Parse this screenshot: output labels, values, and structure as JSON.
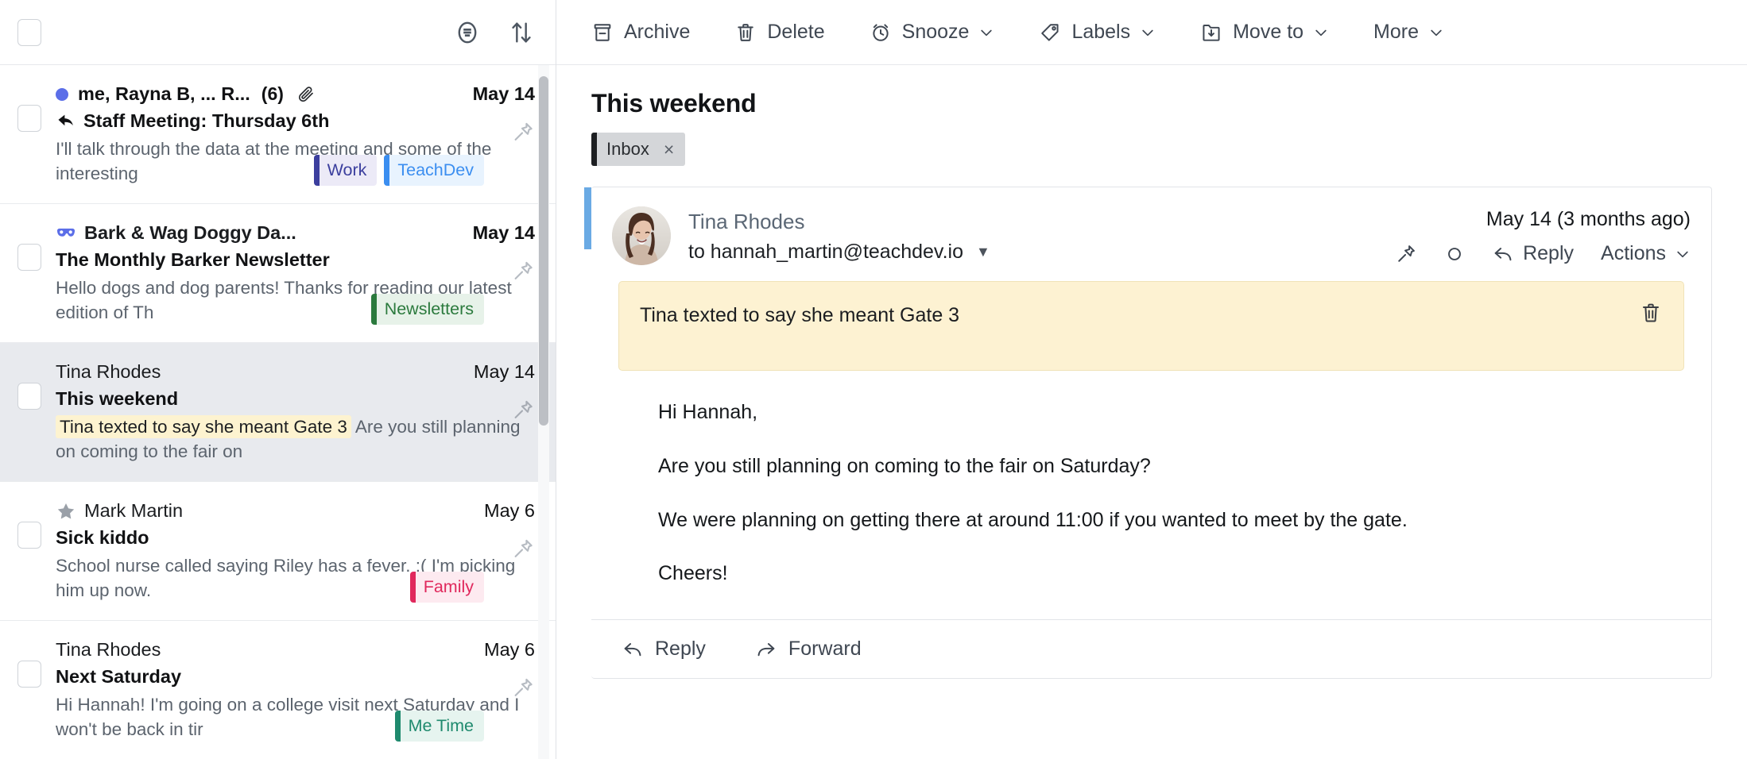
{
  "list_header": {
    "select_all_checkbox": "",
    "filter_icon": "filter-icon",
    "sort_icon": "sort-icon"
  },
  "messages": [
    {
      "sender": "me, Rayna B, ... R...",
      "count": "(6)",
      "date": "May 14",
      "subject": "Staff Meeting: Thursday 6th",
      "snippet": "I'll talk through the data at the meeting and some of the interesting",
      "unread": true,
      "has_attachment": true,
      "replied": true,
      "pre_icon": "",
      "labels": [
        {
          "text": "Work",
          "bar": "#3c3f9e",
          "bg": "#eceaf7",
          "fg": "#3c3f9e"
        },
        {
          "text": "TeachDev",
          "bar": "#3b8ef0",
          "bg": "#e8f3fe",
          "fg": "#3b8ef0"
        }
      ]
    },
    {
      "sender": "Bark & Wag Doggy Da...",
      "count": "",
      "date": "May 14",
      "subject": "The Monthly Barker Newsletter",
      "snippet": "Hello dogs and dog parents! Thanks for reading our latest edition of Th",
      "unread": false,
      "has_attachment": false,
      "replied": false,
      "pre_icon": "mask-icon",
      "labels": [
        {
          "text": "Newsletters",
          "bar": "#2b7a3d",
          "bg": "#e7f2e9",
          "fg": "#2b7a3d"
        }
      ]
    },
    {
      "sender": "Tina Rhodes",
      "count": "",
      "date": "May 14",
      "subject": "This weekend",
      "snippet_note": "Tina texted to say she meant Gate 3",
      "snippet": " Are you still planning on coming to the fair on",
      "unread": false,
      "selected": true,
      "has_attachment": false,
      "replied": false,
      "pre_icon": "",
      "labels": []
    },
    {
      "sender": "Mark Martin",
      "count": "",
      "date": "May 6",
      "subject": "Sick kiddo",
      "snippet": "School nurse called saying Riley has a fever. :( I'm picking him up now.",
      "unread": false,
      "has_attachment": false,
      "replied": false,
      "pre_icon": "star-icon",
      "labels": [
        {
          "text": "Family",
          "bar": "#e0285c",
          "bg": "#fdeaf0",
          "fg": "#e0285c"
        }
      ]
    },
    {
      "sender": "Tina Rhodes",
      "count": "",
      "date": "May 6",
      "subject": "Next Saturday",
      "snippet": "Hi Hannah! I'm going on a college visit next Saturday and I won't be back in tir",
      "unread": false,
      "has_attachment": false,
      "replied": false,
      "pre_icon": "",
      "labels": [
        {
          "text": "Me Time",
          "bar": "#1f8a6e",
          "bg": "#e6f4ef",
          "fg": "#1f8a6e"
        }
      ]
    }
  ],
  "toolbar": {
    "archive": "Archive",
    "delete": "Delete",
    "snooze": "Snooze",
    "labels": "Labels",
    "move_to": "Move to",
    "more": "More"
  },
  "thread": {
    "title": "This weekend",
    "folder_chip": "Inbox",
    "folder_chip_close": "×"
  },
  "message": {
    "sender_name": "Tina Rhodes",
    "recipient": "to hannah_martin@teachdev.io",
    "recipient_caret": "▼",
    "date": "May 14 (3 months ago)",
    "reply_label": "Reply",
    "actions_label": "Actions",
    "note": "Tina texted to say she meant Gate 3",
    "body": [
      "Hi Hannah,",
      "Are you still planning on coming to the fair on Saturday?",
      "We were planning on getting there at around 11:00 if you wanted to meet by the gate.",
      "Cheers!"
    ],
    "footer_reply": "Reply",
    "footer_forward": "Forward"
  },
  "colors": {
    "unread_dot": "#5b6ee8",
    "accent_bar": "#6aaae4",
    "note_bg": "#fdf2d2",
    "selected_row": "#e8eaee"
  }
}
